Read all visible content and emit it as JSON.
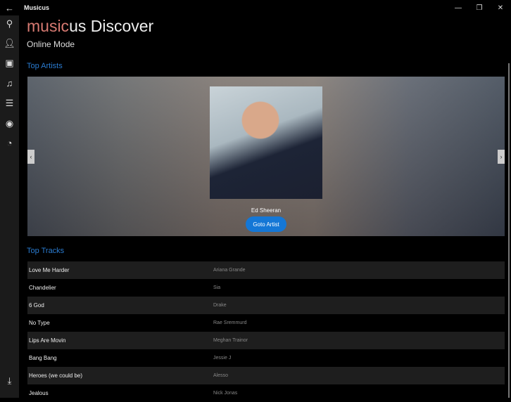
{
  "window": {
    "title": "Musicus",
    "back_icon": "arrow-left"
  },
  "header": {
    "brand": "music",
    "title_rest": "us Discover",
    "mode": "Online Mode"
  },
  "sidebar": {
    "items": [
      "search",
      "artists",
      "albums",
      "songs",
      "playlists",
      "radio",
      "online",
      "download"
    ]
  },
  "top_artists": {
    "label": "Top Artists",
    "artist": "Ed Sheeran",
    "button": "Goto Artist"
  },
  "top_tracks": {
    "label": "Top Tracks",
    "rows": [
      {
        "title": "Love Me Harder",
        "artist": "Ariana Grande"
      },
      {
        "title": "Chandelier",
        "artist": "Sia"
      },
      {
        "title": "6 God",
        "artist": "Drake"
      },
      {
        "title": "No Type",
        "artist": "Rae Sremmurd"
      },
      {
        "title": "Lips Are Movin",
        "artist": "Meghan Trainor"
      },
      {
        "title": "Bang Bang",
        "artist": "Jessie J"
      },
      {
        "title": "Heroes (we could be)",
        "artist": "Alesso"
      },
      {
        "title": "Jealous",
        "artist": "Nick Jonas"
      }
    ]
  },
  "colors": {
    "accent": "#1477d6",
    "brand": "#d77a72",
    "section": "#2a7bd0"
  }
}
